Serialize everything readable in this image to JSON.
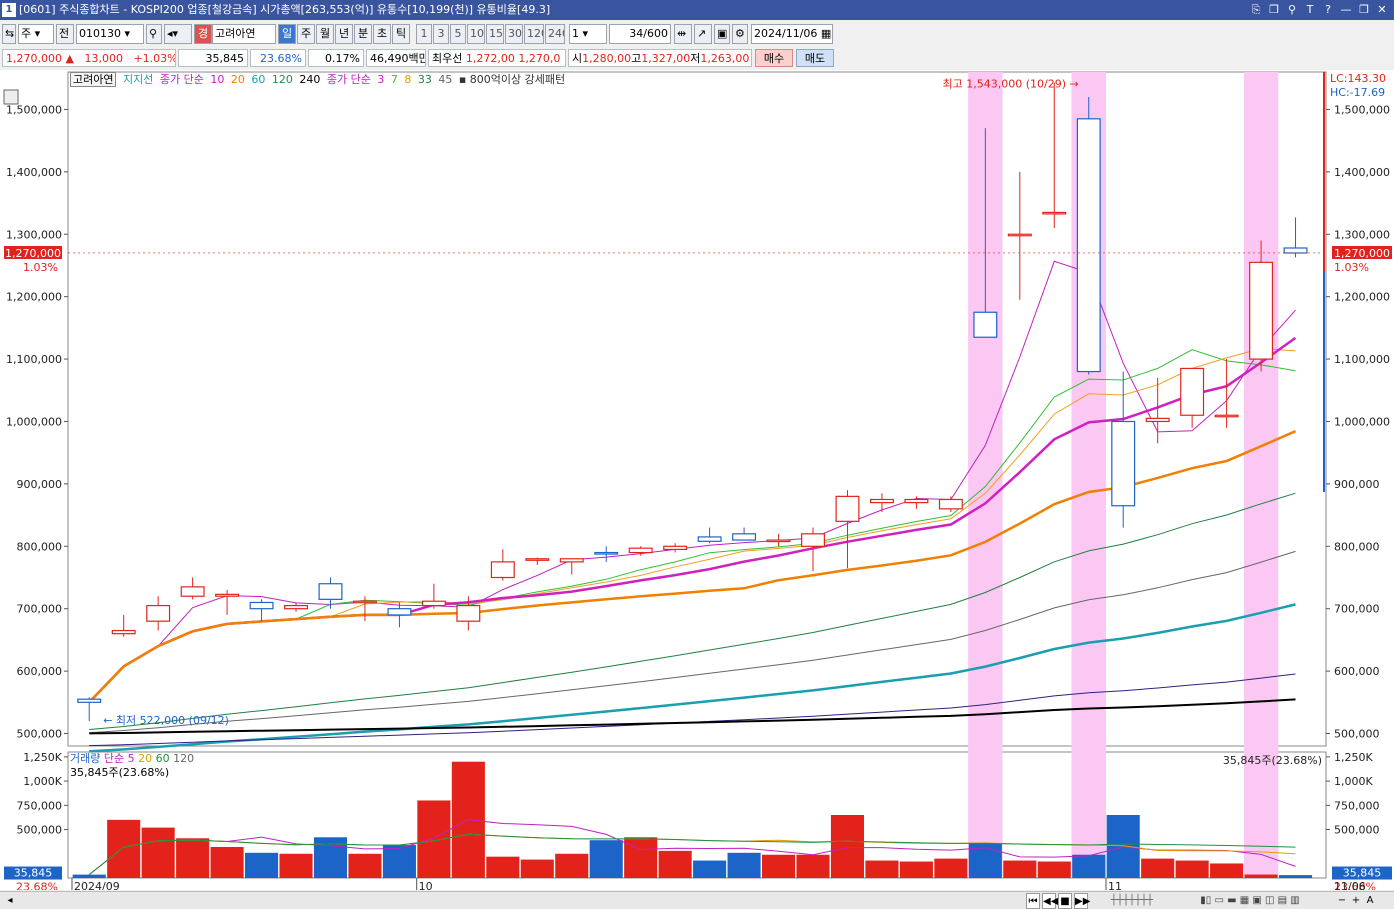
{
  "window": {
    "number": "1",
    "title": "[0601] 주식종합차트 - KOSPI200 업종[철강금속] 시가총액[263,553(억)] 유통수[10,199(천)] 유통비율[49.3]",
    "controls": [
      "⎘",
      "❐",
      "⚲",
      "T",
      "?",
      "—",
      "❐",
      "✕"
    ]
  },
  "toolbar": {
    "market": "주",
    "prev_label": "전",
    "code": "010130",
    "flag": "경",
    "stock_name": "고려아연",
    "periods": [
      "일",
      "주",
      "월",
      "년",
      "분",
      "초",
      "틱"
    ],
    "active_period": "일",
    "intervals": [
      "1",
      "3",
      "5",
      "10",
      "15",
      "30",
      "120",
      "240"
    ],
    "unit_value": "1",
    "count": "34",
    "count_max": "/600",
    "date": "2024/11/06"
  },
  "quote": {
    "price": "1,270,000",
    "arrow": "▲",
    "change": "13,000",
    "change_pct": "+1.03%",
    "volume": "35,845",
    "turnover_pct": "23.68%",
    "ratio": "0.17%",
    "amount": "46,490백만",
    "best_ask_label": "최우선",
    "best_ask": "1,272,00",
    "best_bid": "1,270,0",
    "open_label": "시",
    "open": "1,280,00",
    "high_label": "고",
    "high": "1,327,00",
    "low_label": "저",
    "low": "1,263,00",
    "buy": "매수",
    "sell": "매도"
  },
  "legend": {
    "name": "고려아연",
    "support": "지지선",
    "ma_label": "종가 단순",
    "ma_periods": [
      "10",
      "20",
      "60",
      "120",
      "240"
    ],
    "ma2_label": "종가 단순",
    "ma2_periods": [
      "3",
      "7",
      "8",
      "33",
      "45"
    ],
    "pattern": "800억이상 강세패턴"
  },
  "price_axis": {
    "ticks": [
      "1,500,000",
      "1,400,000",
      "1,300,000",
      "1,200,000",
      "1,100,000",
      "1,000,000",
      "900,000",
      "800,000",
      "700,000",
      "600,000",
      "500,000"
    ],
    "current_label": "1,270,000",
    "current_pct": "1.03%",
    "lc": "LC:143.30",
    "hc": "HC:-17.69"
  },
  "annotations": {
    "high": "최고 1,543,000 (10/29)",
    "low": "최저 522,000 (09/12)"
  },
  "volume_panel": {
    "legend_label": "거래량",
    "ma_label": "단순",
    "ma_periods": [
      "5",
      "20",
      "60",
      "120"
    ],
    "current": "35,845주(23.68%)",
    "current_right": "35,845주(23.68%)",
    "ticks": [
      "1,250K",
      "1,000K",
      "750,000",
      "500,000"
    ],
    "current_value": "35,845",
    "current_pct": "23.68%"
  },
  "date_axis": {
    "labels": [
      "2024/09",
      "10",
      "11"
    ],
    "last": "11/06"
  },
  "colors": {
    "up": "#e3231b",
    "down": "#1c64c8",
    "highlight": "#fbc8f4"
  },
  "chart_data": {
    "type": "candlestick",
    "dates": [
      "09/10",
      "09/11",
      "09/12",
      "09/13",
      "09/19",
      "09/20",
      "09/23",
      "09/24",
      "09/25",
      "09/26",
      "09/27",
      "09/30",
      "10/02",
      "10/04",
      "10/07",
      "10/08",
      "10/10",
      "10/11",
      "10/14",
      "10/15",
      "10/16",
      "10/17",
      "10/18",
      "10/21",
      "10/22",
      "10/23",
      "10/24",
      "10/25",
      "10/28",
      "10/29",
      "10/30",
      "10/31",
      "11/01",
      "11/04",
      "11/05",
      "11/06"
    ],
    "open": [
      555000,
      660000,
      680000,
      720000,
      720000,
      710000,
      700000,
      740000,
      710000,
      700000,
      705000,
      680000,
      750000,
      780000,
      775000,
      790000,
      790000,
      795000,
      815000,
      820000,
      810000,
      800000,
      840000,
      870000,
      870000,
      860000,
      1175000,
      1300000,
      1335000,
      1485000,
      1000000,
      1000000,
      1010000,
      1010000,
      1100000,
      1278000
    ],
    "high": [
      558000,
      690000,
      720000,
      750000,
      730000,
      715000,
      710000,
      750000,
      720000,
      710000,
      740000,
      720000,
      795000,
      782000,
      780000,
      800000,
      800000,
      805000,
      830000,
      830000,
      820000,
      830000,
      890000,
      885000,
      880000,
      880000,
      1470000,
      1400000,
      1543000,
      1520000,
      1080000,
      1070000,
      1050000,
      1100000,
      1290000,
      1327000
    ],
    "low": [
      520000,
      655000,
      665000,
      715000,
      690000,
      680000,
      695000,
      700000,
      680000,
      670000,
      700000,
      665000,
      745000,
      770000,
      755000,
      775000,
      785000,
      790000,
      805000,
      810000,
      800000,
      760000,
      765000,
      855000,
      860000,
      855000,
      1150000,
      1195000,
      1310000,
      1075000,
      830000,
      965000,
      990000,
      990000,
      1080000,
      1263000
    ],
    "close": [
      550000,
      665000,
      705000,
      735000,
      723000,
      700000,
      705000,
      715000,
      712000,
      690000,
      712000,
      705000,
      775000,
      780000,
      780000,
      788000,
      797000,
      800000,
      808000,
      810000,
      810000,
      820000,
      880000,
      875000,
      875000,
      875000,
      1135000,
      1300000,
      1335000,
      1080000,
      865000,
      1005000,
      1085000,
      1010000,
      1255000,
      1270000
    ],
    "volume": [
      35000,
      600000,
      520000,
      410000,
      320000,
      260000,
      250000,
      420000,
      250000,
      340000,
      800000,
      1200000,
      220000,
      190000,
      250000,
      390000,
      420000,
      280000,
      180000,
      260000,
      240000,
      240000,
      650000,
      180000,
      170000,
      200000,
      360000,
      180000,
      170000,
      240000,
      650000,
      200000,
      180000,
      150000,
      35845,
      30000
    ],
    "highlight_index": [
      26,
      29,
      34
    ]
  }
}
